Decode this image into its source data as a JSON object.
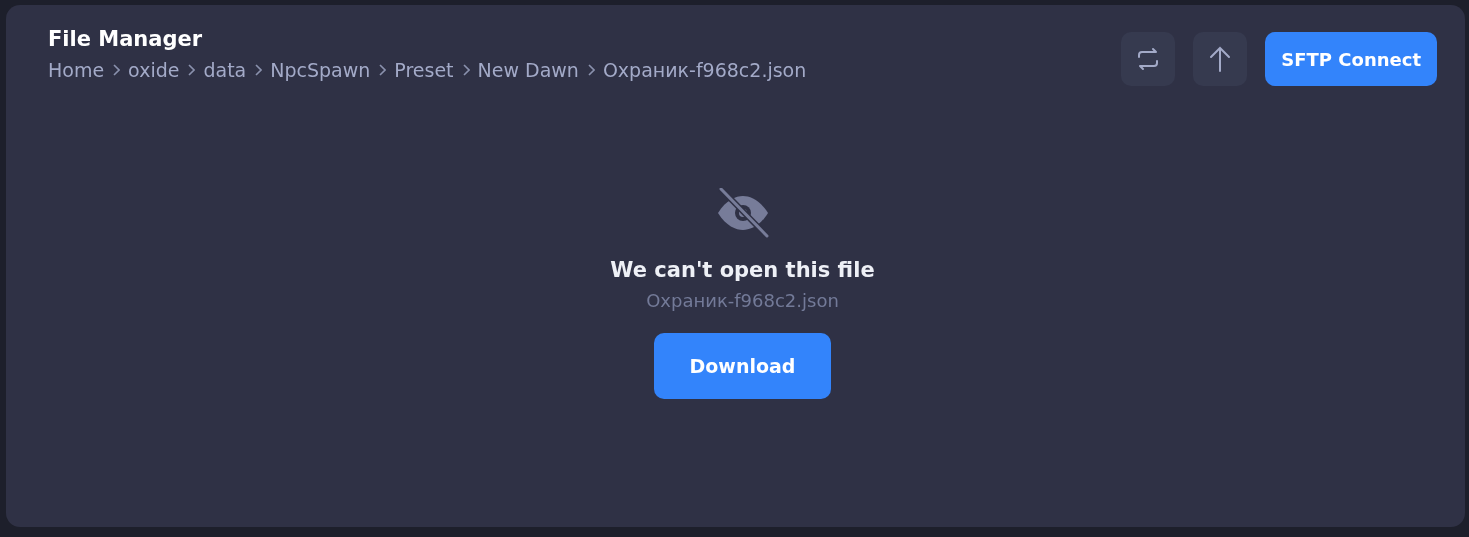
{
  "title": "File Manager",
  "breadcrumbs": [
    "Home",
    "oxide",
    "data",
    "NpcSpawn",
    "Preset",
    "New Dawn",
    "Охраник-f968c2.json"
  ],
  "actions": {
    "connect_label": "SFTP Connect"
  },
  "empty_state": {
    "heading": "We can't open this file",
    "file_name": "Охраник-f968c2.json",
    "button": "Download"
  }
}
